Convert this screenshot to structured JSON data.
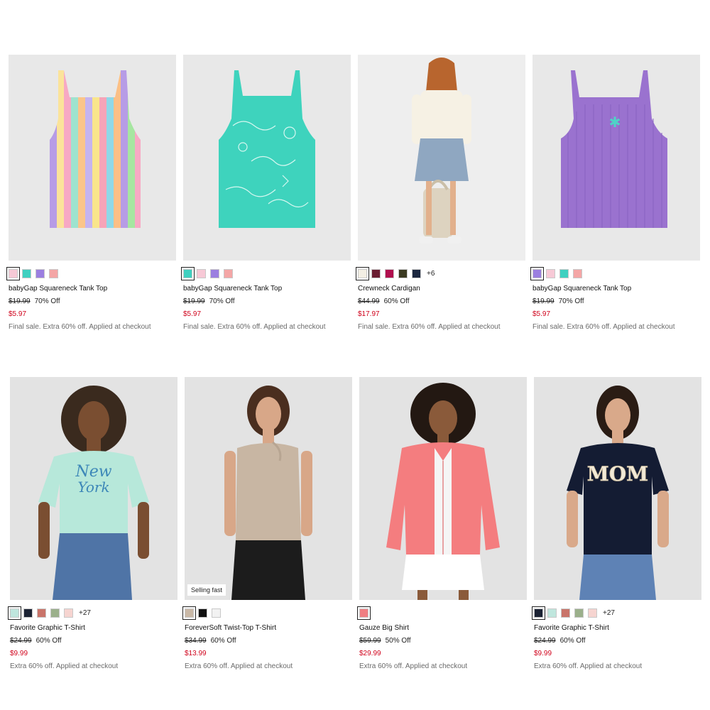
{
  "products": [
    {
      "title": "babyGap Squareneck Tank Top",
      "was": "$19.99",
      "off": "70% Off",
      "now": "$5.97",
      "note": "Final sale. Extra 60% off. Applied at checkout",
      "swatches": [
        "#f7c9d6",
        "#3fd0c0",
        "#9b7fe0",
        "#f4a6a6"
      ],
      "selected": 0,
      "more": ""
    },
    {
      "title": "babyGap Squareneck Tank Top",
      "was": "$19.99",
      "off": "70% Off",
      "now": "$5.97",
      "note": "Final sale. Extra 60% off. Applied at checkout",
      "swatches": [
        "#3fd0c0",
        "#f7c9d6",
        "#9b7fe0",
        "#f4a6a6"
      ],
      "selected": 0,
      "more": ""
    },
    {
      "title": "Crewneck Cardigan",
      "was": "$44.99",
      "off": "60% Off",
      "now": "$17.97",
      "note": "Final sale. Extra 60% off. Applied at checkout",
      "swatches": [
        "#f3efe4",
        "#6b1e33",
        "#b0104e",
        "#3b3a22",
        "#1c2840"
      ],
      "selected": 0,
      "more": "+6"
    },
    {
      "title": "babyGap Squareneck Tank Top",
      "was": "$19.99",
      "off": "70% Off",
      "now": "$5.97",
      "note": "Final sale. Extra 60% off. Applied at checkout",
      "swatches": [
        "#9b7fe0",
        "#f7c9d6",
        "#3fd0c0",
        "#f4a6a6"
      ],
      "selected": 0,
      "more": ""
    },
    {
      "title": "Favorite Graphic T-Shirt",
      "was": "$24.99",
      "off": "60% Off",
      "now": "$9.99",
      "note": "Extra 60% off. Applied at checkout",
      "swatches": [
        "#bfe6dd",
        "#1b2233",
        "#c9746a",
        "#9bb08b",
        "#f6d4d0"
      ],
      "selected": 0,
      "more": "+27"
    },
    {
      "title": "ForeverSoft Twist-Top T-Shirt",
      "was": "$34.99",
      "off": "60% Off",
      "now": "$13.99",
      "note": "Extra 60% off. Applied at checkout",
      "swatches": [
        "#c9b8a6",
        "#111111",
        "#f2f2f2"
      ],
      "selected": 0,
      "more": "",
      "badge": "Selling fast"
    },
    {
      "title": "Gauze Big Shirt",
      "was": "$59.99",
      "off": "50% Off",
      "now": "$29.99",
      "note": "Extra 60% off. Applied at checkout",
      "swatches": [
        "#f07e82"
      ],
      "selected": 0,
      "more": ""
    },
    {
      "title": "Favorite Graphic T-Shirt",
      "was": "$24.99",
      "off": "60% Off",
      "now": "$9.99",
      "note": "Extra 60% off. Applied at checkout",
      "swatches": [
        "#1b2233",
        "#bfe6dd",
        "#c9746a",
        "#9bb08b",
        "#f6d4d0"
      ],
      "selected": 0,
      "more": "+27"
    }
  ]
}
